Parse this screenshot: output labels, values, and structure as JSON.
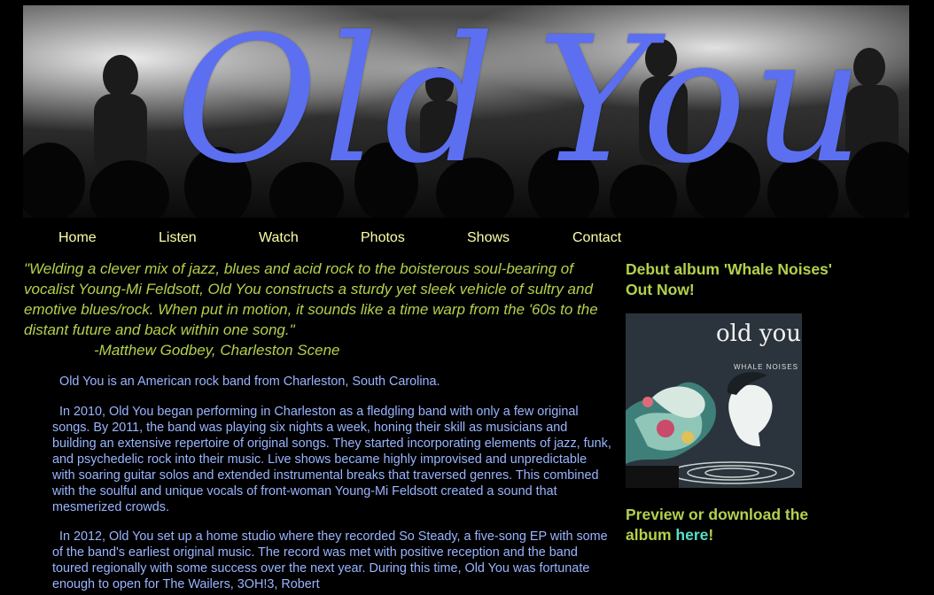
{
  "header": {
    "band_name_part1": "Old",
    "band_name_part2": "You",
    "title_color": "#5b6ff0"
  },
  "nav": {
    "items": [
      {
        "label": "Home"
      },
      {
        "label": "Listen"
      },
      {
        "label": "Watch"
      },
      {
        "label": "Photos"
      },
      {
        "label": "Shows"
      },
      {
        "label": "Contact"
      }
    ],
    "color": "#ffffa8"
  },
  "quote": {
    "text": "\"Welding a clever mix of jazz, blues and acid rock to the boisterous soul-bearing of vocalist Young-Mi Feldsott, Old You constructs a sturdy yet sleek vehicle of sultry and emotive blues/rock. When put in motion, it sounds like a time warp from the '60s to the distant future and back within one song.\"",
    "attribution": "-Matthew Godbey, Charleston Scene"
  },
  "bio": {
    "p1": "Old You is an American rock band from Charleston, South Carolina.",
    "p2": "In 2010, Old You began performing in Charleston as a fledgling band with only a few original songs. By 2011, the band was playing six nights a week, honing their skill as musicians and building an extensive repertoire of original songs. They started incorporating elements of jazz, funk, and psychedelic rock into their music. Live shows became highly improvised and unpredictable with soaring guitar solos and extended instrumental breaks that traversed genres. This combined with the soulful and unique vocals of front-woman Young-Mi Feldsott created a sound that mesmerized crowds.",
    "p3": "In 2012, Old You set up a home studio where they recorded So Steady, a five-song EP with some of the band's earliest original music. The record was met with positive reception and the band toured regionally with some success over the next year. During this time, Old You was fortunate enough to open for The Wailers, 3OH!3, Robert"
  },
  "sidebar": {
    "heading": "Debut album 'Whale Noises' Out Now!",
    "album_title": "old you",
    "album_subtitle": "WHALE NOISES",
    "preview_text": "Preview or download the album",
    "preview_link": "here",
    "preview_suffix": "!"
  },
  "colors": {
    "background": "#000000",
    "quote": "#b4d14c",
    "bio_text": "#9ab4ff",
    "link": "#55e0c8"
  }
}
